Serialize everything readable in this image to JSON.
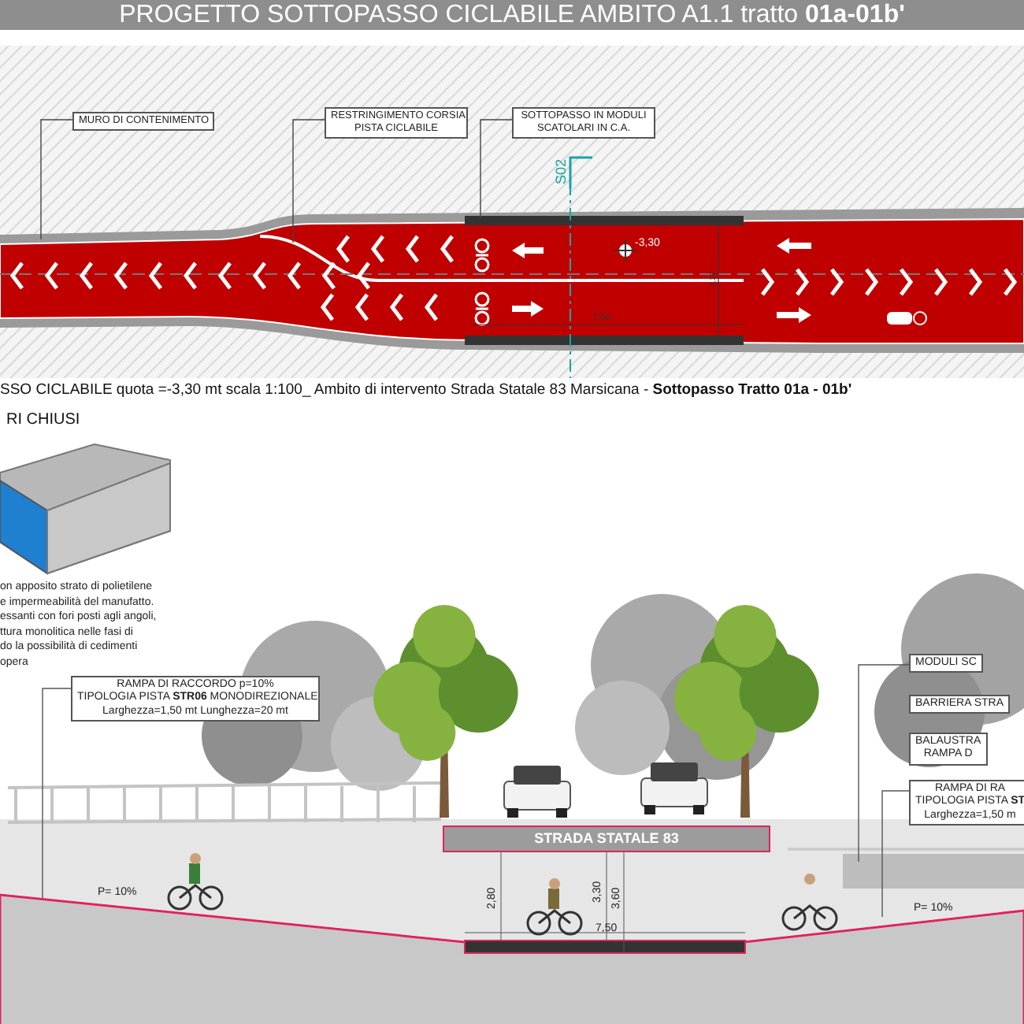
{
  "title": "PROGETTO SOTTOPASSO CICLABILE AMBITO A1.1 tratto **01a-01b'**",
  "plan": {
    "labels": [
      {
        "lines": [
          "MURO DI CONTENIMENTO"
        ]
      },
      {
        "lines": [
          "RESTRINGIMENTO CORSIA",
          "PISTA CICLABILE"
        ]
      },
      {
        "lines": [
          "SOTTOPASSO IN MODULI",
          "SCATOLARI IN C.A."
        ]
      }
    ],
    "section_mark": "S02",
    "level_mark": "-3,30",
    "width_dim": "7,50",
    "height_dim": "3,30"
  },
  "caption": "SSO CICLABILE quota =-3,30 mt scala 1:100_ Ambito di intervento Strada Statale 83 Marsicana - **Sottopasso Tratto 01a - 01b'**",
  "detail": {
    "heading": "RI CHIUSI",
    "paragraph": [
      "on apposito strato di polietilene",
      "e impermeabilità del manufatto.",
      "essanti con fori posti agli angoli,",
      "ttura monolitica nelle fasi di",
      "do la possibilità di cedimenti",
      "opera"
    ]
  },
  "section": {
    "road_label": "STRADA STATALE 83",
    "labels": [
      {
        "lines": [
          "RAMPA DI RACCORDO p=10%",
          "TIPOLOGIA PISTA **STR06** MONODIREZIONALE",
          "Larghezza=1,50 mt Lunghezza=20 mt"
        ]
      },
      {
        "lines": [
          "MODULI SC"
        ]
      },
      {
        "lines": [
          "BARRIERA STRA"
        ]
      },
      {
        "lines": [
          "BALAUSTRA",
          "RAMPA D"
        ]
      },
      {
        "lines": [
          "RAMPA DI RA",
          "TIPOLOGIA PISTA **ST**",
          "Larghezza=1,50 m"
        ]
      }
    ],
    "slopes": [
      "P= 10%",
      "P= 10%"
    ],
    "dims": [
      "2,80",
      "3,30",
      "3,60",
      "7,50"
    ]
  }
}
